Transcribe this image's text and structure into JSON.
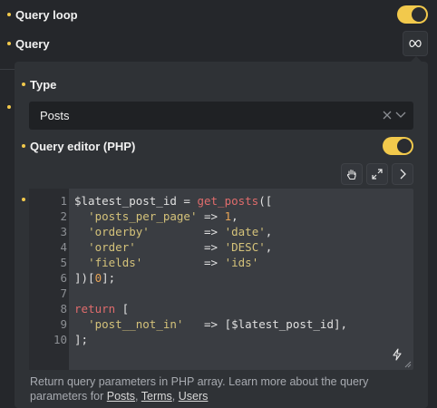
{
  "query_loop": {
    "label": "Query loop",
    "enabled": true
  },
  "query": {
    "label": "Query",
    "icon": "infinity-icon"
  },
  "type": {
    "label": "Type",
    "value": "Posts"
  },
  "query_editor": {
    "label": "Query editor (PHP)",
    "enabled": true
  },
  "editor_toolbar": [
    "hand-icon",
    "expand-icon",
    "chevron-right-icon"
  ],
  "code": {
    "line_numbers": [
      "1",
      "2",
      "3",
      "4",
      "5",
      "6",
      "7",
      "8",
      "9",
      "10"
    ]
  },
  "description": {
    "text": "Return query parameters in PHP array. Learn more about the query parameters for ",
    "links": [
      "Posts",
      "Terms",
      "Users"
    ],
    "sep1": ", ",
    "sep2": ", "
  },
  "colors": {
    "accent": "#f2c94c",
    "background": "#25272b",
    "panel": "#2f3236"
  }
}
